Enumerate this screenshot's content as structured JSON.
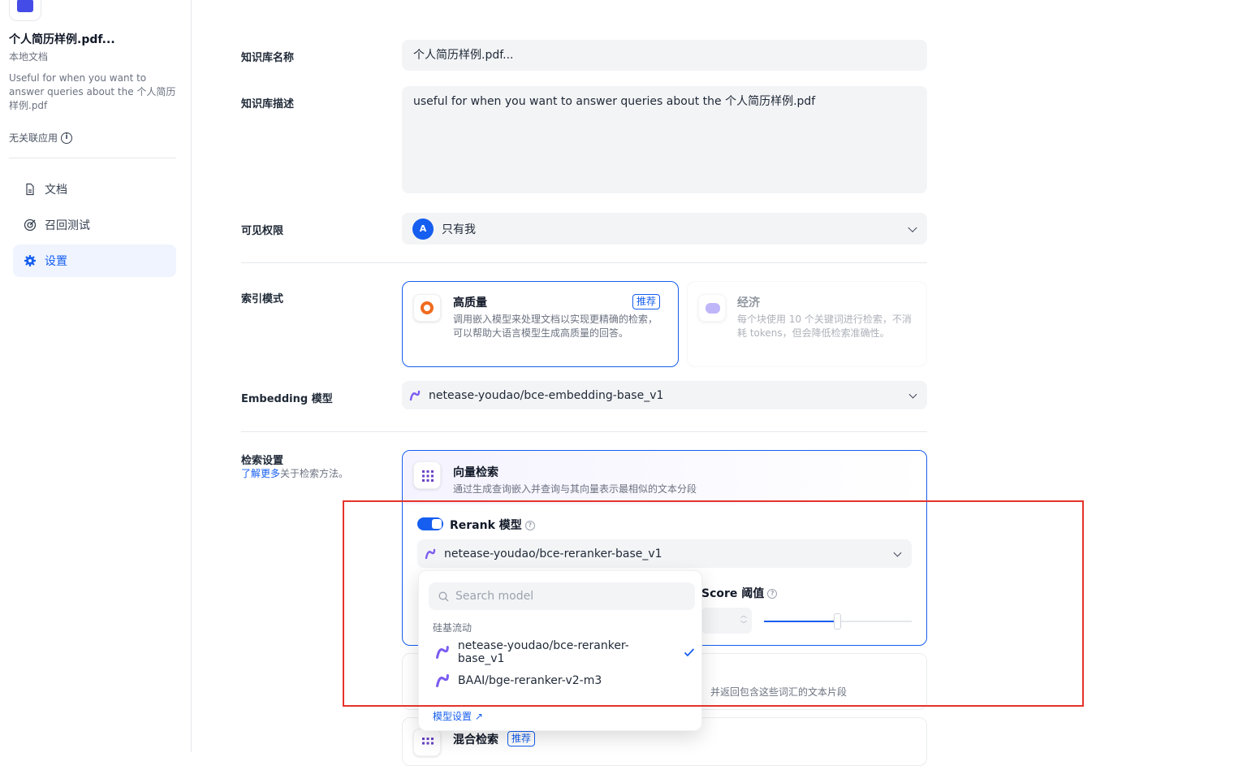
{
  "sidebar": {
    "dataset_name": "个人简历样例.pdf...",
    "dataset_type": "本地文档",
    "dataset_desc": "Useful for when you want to answer queries about the 个人简历样例.pdf",
    "linked_apps": "无关联应用",
    "nav": [
      {
        "label": "文档",
        "icon": "document-icon"
      },
      {
        "label": "召回测试",
        "icon": "target-icon"
      },
      {
        "label": "设置",
        "icon": "gear-icon",
        "active": true
      }
    ]
  },
  "form": {
    "name_label": "知识库名称",
    "name_value": "个人简历样例.pdf...",
    "desc_label": "知识库描述",
    "desc_value": "useful for when you want to answer queries about the 个人简历样例.pdf",
    "permission_label": "可见权限",
    "permission_avatar": "A",
    "permission_value": "只有我",
    "index_label": "索引模式",
    "index_high": {
      "title": "高质量",
      "badge": "推荐",
      "desc": "调用嵌入模型来处理文档以实现更精确的检索，可以帮助大语言模型生成高质量的回答。"
    },
    "index_eco": {
      "title": "经济",
      "desc": "每个块使用 10 个关键词进行检索，不消耗 tokens，但会降低检索准确性。"
    },
    "embedding_label": "Embedding 模型",
    "embedding_value": "netease-youdao/bce-embedding-base_v1",
    "retrieval_label": "检索设置",
    "retrieval_help_link": "了解更多",
    "retrieval_help_text": "关于检索方法。"
  },
  "vector_search": {
    "title": "向量检索",
    "desc": "通过生成查询嵌入并查询与其向量表示最相似的文本分段",
    "rerank_label": "Rerank 模型",
    "rerank_enabled": true,
    "rerank_value": "netease-youdao/bce-reranker-base_v1",
    "score_label": "Score 阈值"
  },
  "fulltext_search": {
    "desc_tail": "并返回包含这些词汇的文本片段"
  },
  "hybrid_search": {
    "title": "混合检索",
    "badge": "推荐"
  },
  "dropdown": {
    "search_placeholder": "Search model",
    "group": "硅基流动",
    "items": [
      {
        "label": "netease-youdao/bce-reranker-base_v1",
        "selected": true
      },
      {
        "label": "BAAI/bge-reranker-v2-m3",
        "selected": false
      }
    ],
    "footer_link": "模型设置 ↗"
  },
  "colors": {
    "accent": "#155eef",
    "highlight": "#e5332a",
    "model_icon": "#7c5cf0"
  }
}
